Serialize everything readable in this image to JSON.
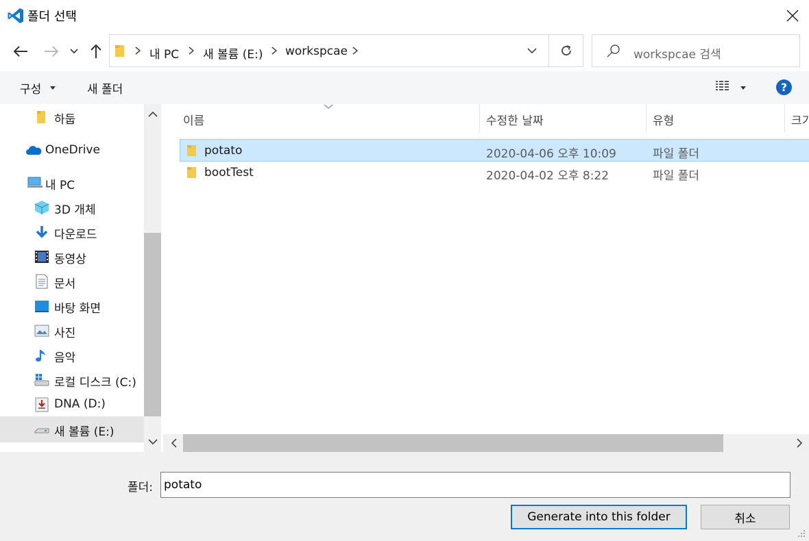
{
  "window": {
    "title": "폴더 선택"
  },
  "address": {
    "breadcrumbs": [
      "내 PC",
      "새 볼륨 (E:)",
      "workspcae"
    ]
  },
  "search": {
    "placeholder": "workspcae 검색"
  },
  "toolbar": {
    "organize": "구성",
    "new_folder": "새 폴더"
  },
  "sidebar": {
    "items": [
      {
        "label": "하둡",
        "icon": "folder-icon"
      },
      {
        "label": "OneDrive",
        "icon": "cloud-icon"
      },
      {
        "label": "내 PC",
        "icon": "computer-icon"
      },
      {
        "label": "3D 개체",
        "icon": "cube-icon"
      },
      {
        "label": "다운로드",
        "icon": "download-icon"
      },
      {
        "label": "동영상",
        "icon": "video-icon"
      },
      {
        "label": "문서",
        "icon": "document-icon"
      },
      {
        "label": "바탕 화면",
        "icon": "desktop-icon"
      },
      {
        "label": "사진",
        "icon": "picture-icon"
      },
      {
        "label": "음악",
        "icon": "music-icon"
      },
      {
        "label": "로컬 디스크 (C:)",
        "icon": "drive-icon"
      },
      {
        "label": "DNA (D:)",
        "icon": "usb-drive-icon"
      },
      {
        "label": "새 볼륨 (E:)",
        "icon": "drive-icon"
      }
    ],
    "selected": "새 볼륨 (E:)"
  },
  "files": {
    "columns": [
      "이름",
      "수정한 날짜",
      "유형",
      "크기"
    ],
    "rows": [
      {
        "name": "potato",
        "date": "2020-04-06 오후 10:09",
        "type": "파일 폴더",
        "selected": true
      },
      {
        "name": "bootTest",
        "date": "2020-04-02 오후 8:22",
        "type": "파일 폴더",
        "selected": false
      }
    ]
  },
  "footer": {
    "folder_label": "폴더:",
    "folder_value": "potato",
    "primary_button": "Generate into this folder",
    "cancel_button": "취소"
  },
  "colors": {
    "accent": "#0078d7",
    "selection": "#cce8ff",
    "help": "#1565c0",
    "folder": "#f7c948"
  }
}
